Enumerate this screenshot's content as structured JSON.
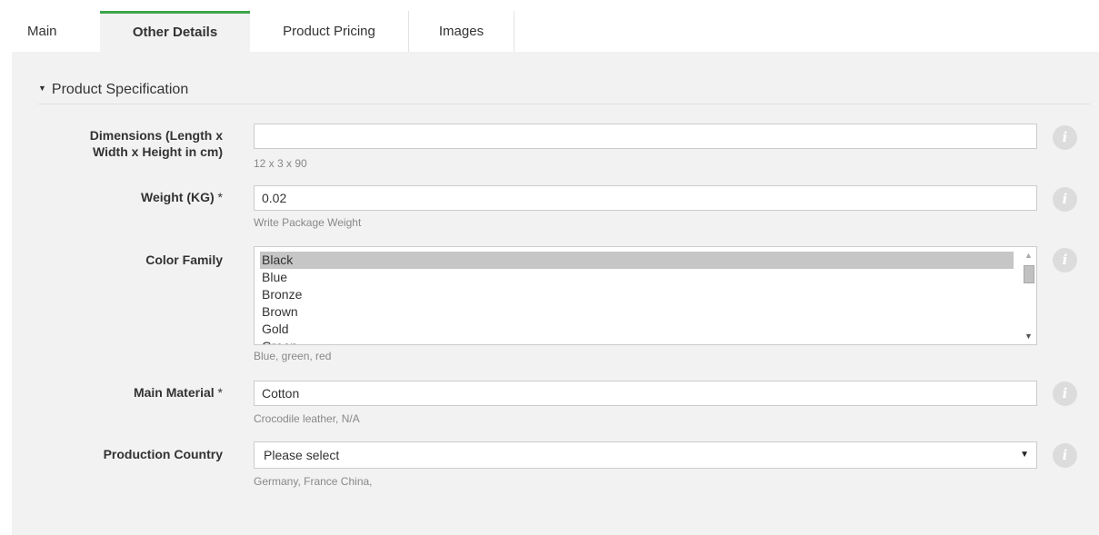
{
  "tabs": [
    {
      "label": "Main"
    },
    {
      "label": "Other Details"
    },
    {
      "label": "Product Pricing"
    },
    {
      "label": "Images"
    }
  ],
  "section": {
    "title": "Product Specification"
  },
  "fields": {
    "dimensions": {
      "label_line1": "Dimensions (Length x",
      "label_line2": "Width x Height in cm)",
      "value": "",
      "hint": "12 x 3 x 90"
    },
    "weight": {
      "label": "Weight (KG)",
      "required_mark": "*",
      "value": "0.02",
      "hint": "Write Package Weight"
    },
    "color_family": {
      "label": "Color Family",
      "options": [
        "Black",
        "Blue",
        "Bronze",
        "Brown",
        "Gold",
        "Green"
      ],
      "selected": "Black",
      "hint": "Blue, green, red"
    },
    "main_material": {
      "label": "Main Material",
      "required_mark": "*",
      "value": "Cotton",
      "hint": "Crocodile leather, N/A"
    },
    "production_country": {
      "label": "Production Country",
      "value": "Please select",
      "hint": "Germany, France China,"
    }
  },
  "info_icon_glyph": "i",
  "colors": {
    "active_tab_accent": "#3da54a",
    "panel_bg": "#f2f2f2",
    "info_icon_bg": "#dcdcdc",
    "selected_option_bg": "#c6c6c6"
  }
}
